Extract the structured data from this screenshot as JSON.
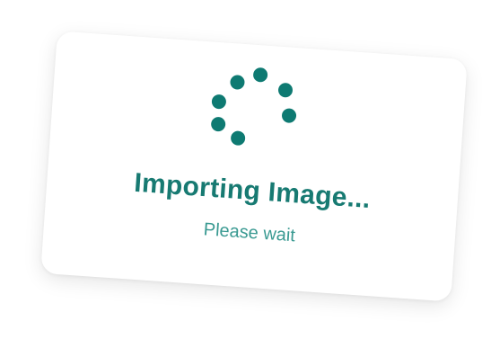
{
  "dialog": {
    "title": "Importing Image...",
    "subtitle": "Please wait"
  },
  "spinner": {
    "icon": "loading-spinner-icon",
    "dot_count": 7
  },
  "colors": {
    "accent": "#0e7a72",
    "title": "#177a72",
    "subtitle": "#3a9a92",
    "background": "#ffffff"
  }
}
